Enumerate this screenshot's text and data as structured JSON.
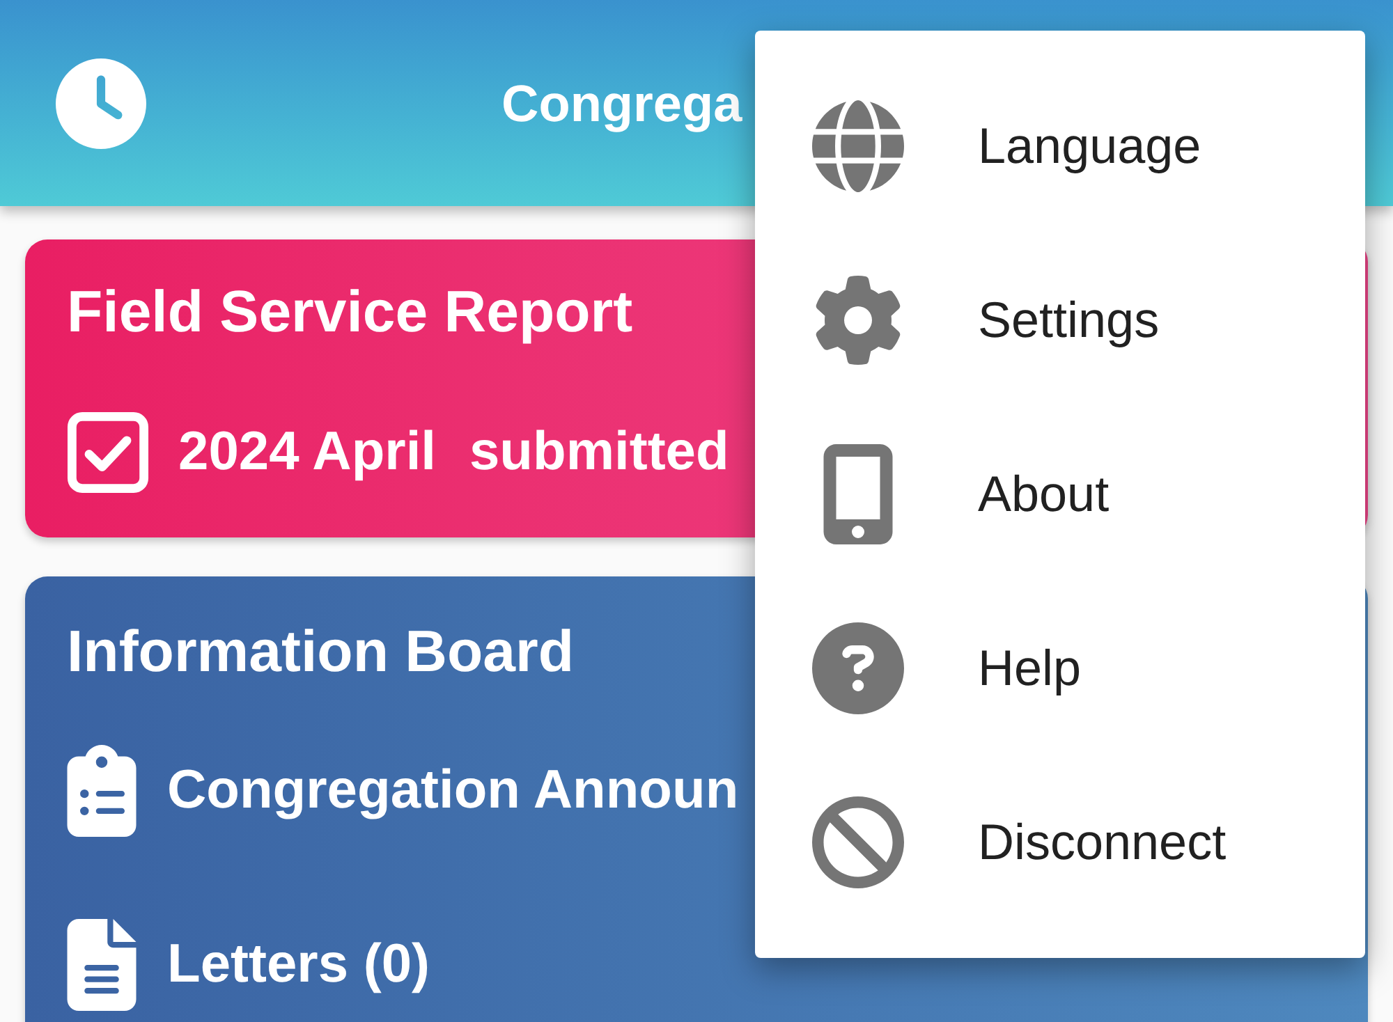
{
  "app_bar": {
    "title": "Congrega"
  },
  "report_card": {
    "title": "Field Service Report",
    "entry": {
      "checked": true,
      "period": "2024 April",
      "status": "submitted"
    }
  },
  "info_board": {
    "title": "Information Board",
    "items": [
      {
        "kind": "announcements",
        "label": "Congregation Announ"
      },
      {
        "kind": "letters",
        "label": "Letters (0)"
      }
    ]
  },
  "overflow_menu": {
    "items": [
      {
        "kind": "language",
        "label": "Language"
      },
      {
        "kind": "settings",
        "label": "Settings"
      },
      {
        "kind": "about",
        "label": "About"
      },
      {
        "kind": "help",
        "label": "Help"
      },
      {
        "kind": "disconnect",
        "label": "Disconnect"
      }
    ]
  }
}
